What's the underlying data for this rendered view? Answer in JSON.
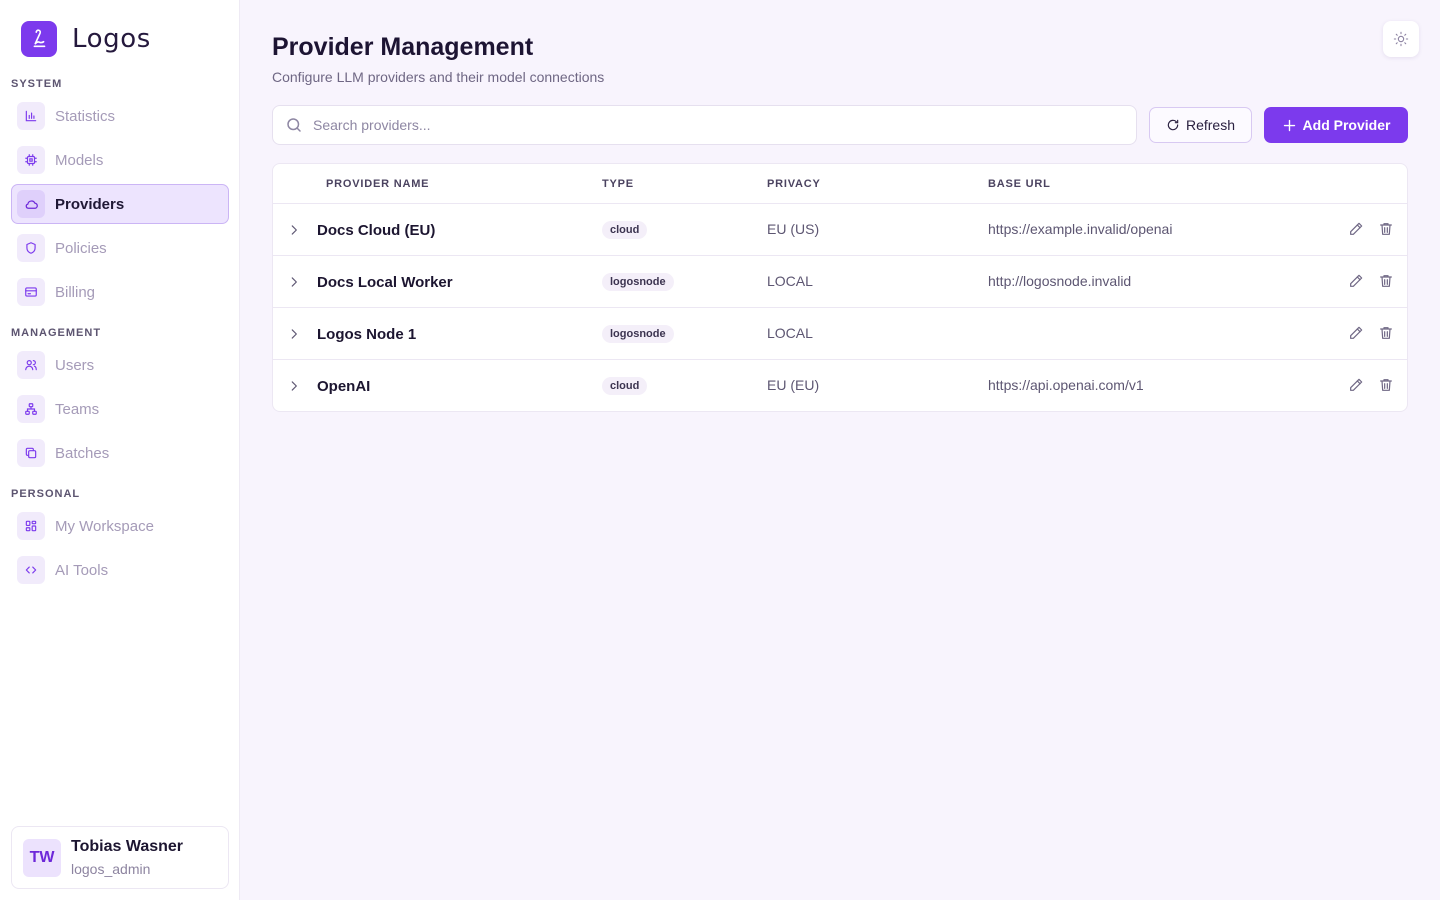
{
  "brand": {
    "name": "Logos"
  },
  "sidebar": {
    "sections": [
      {
        "title": "SYSTEM",
        "items": [
          {
            "label": "Statistics",
            "icon": "chart-icon"
          },
          {
            "label": "Models",
            "icon": "chip-icon"
          },
          {
            "label": "Providers",
            "icon": "cloud-icon",
            "active": true
          },
          {
            "label": "Policies",
            "icon": "shield-icon"
          },
          {
            "label": "Billing",
            "icon": "credit-card-icon"
          }
        ]
      },
      {
        "title": "MANAGEMENT",
        "items": [
          {
            "label": "Users",
            "icon": "users-icon"
          },
          {
            "label": "Teams",
            "icon": "team-tree-icon"
          },
          {
            "label": "Batches",
            "icon": "copy-icon"
          }
        ]
      },
      {
        "title": "PERSONAL",
        "items": [
          {
            "label": "My Workspace",
            "icon": "grid-icon"
          },
          {
            "label": "AI Tools",
            "icon": "code-icon"
          }
        ]
      }
    ]
  },
  "user": {
    "initials": "TW",
    "name": "Tobias Wasner",
    "role": "logos_admin"
  },
  "page": {
    "title": "Provider Management",
    "subtitle": "Configure LLM providers and their model connections"
  },
  "search": {
    "placeholder": "Search providers..."
  },
  "toolbar": {
    "refresh_label": "Refresh",
    "add_label": "Add Provider"
  },
  "table": {
    "columns": [
      "PROVIDER NAME",
      "TYPE",
      "PRIVACY",
      "BASE URL"
    ],
    "rows": [
      {
        "name": "Docs Cloud (EU)",
        "type": "cloud",
        "privacy": "EU (US)",
        "url": "https://example.invalid/openai"
      },
      {
        "name": "Docs Local Worker",
        "type": "logosnode",
        "privacy": "LOCAL",
        "url": "http://logosnode.invalid"
      },
      {
        "name": "Logos Node 1",
        "type": "logosnode",
        "privacy": "LOCAL",
        "url": ""
      },
      {
        "name": "OpenAI",
        "type": "cloud",
        "privacy": "EU (EU)",
        "url": "https://api.openai.com/v1"
      }
    ]
  },
  "colors": {
    "accent": "#7c3aed",
    "background": "#f8f4fd",
    "muted_text": "#a59bb8"
  }
}
